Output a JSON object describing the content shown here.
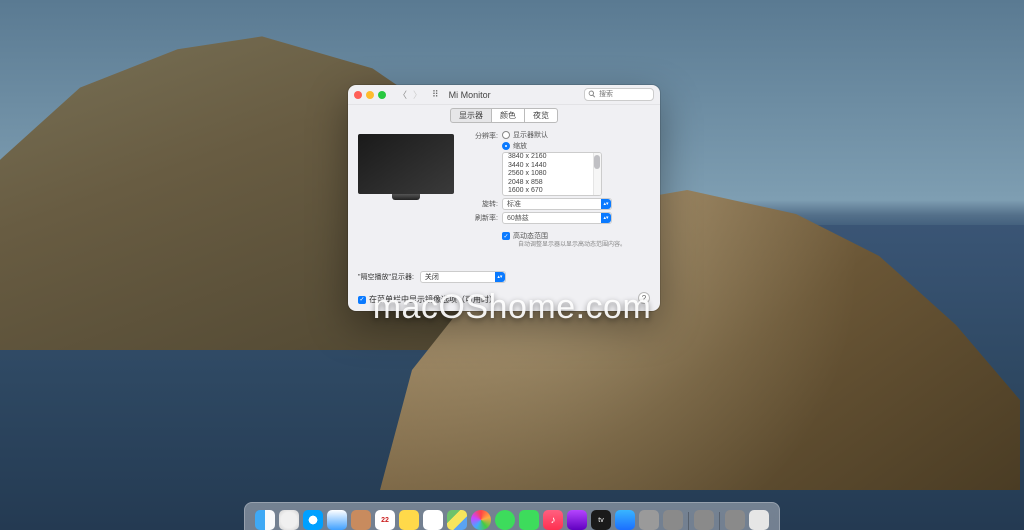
{
  "window": {
    "title": "Mi Monitor",
    "search_placeholder": "搜索",
    "tabs": {
      "display": "显示器",
      "color": "颜色",
      "nightshift": "夜览"
    },
    "resolution": {
      "label": "分辨率:",
      "default_option": "显示器默认",
      "scaled_option": "缩放",
      "options": [
        "3840 x 2160",
        "3440 x 1440",
        "2560 x 1080",
        "2048 x 858",
        "1600 x 670"
      ]
    },
    "rotation": {
      "label": "旋转:",
      "value": "标准"
    },
    "refresh": {
      "label": "刷新率:",
      "value": "60赫兹"
    },
    "hdr": {
      "label": "高动态范围",
      "hint": "自动调整显示器以显示高动态范围内容。"
    },
    "airplay": {
      "label": "\"隔空播放\"显示器:",
      "value": "关闭"
    },
    "mirroring": {
      "label": "在菜单栏中显示镜像选项（可用时）"
    },
    "help": "?"
  },
  "watermark": "macOShome.com",
  "dock": {
    "calendar_date": "22",
    "tv_label": "tv"
  }
}
